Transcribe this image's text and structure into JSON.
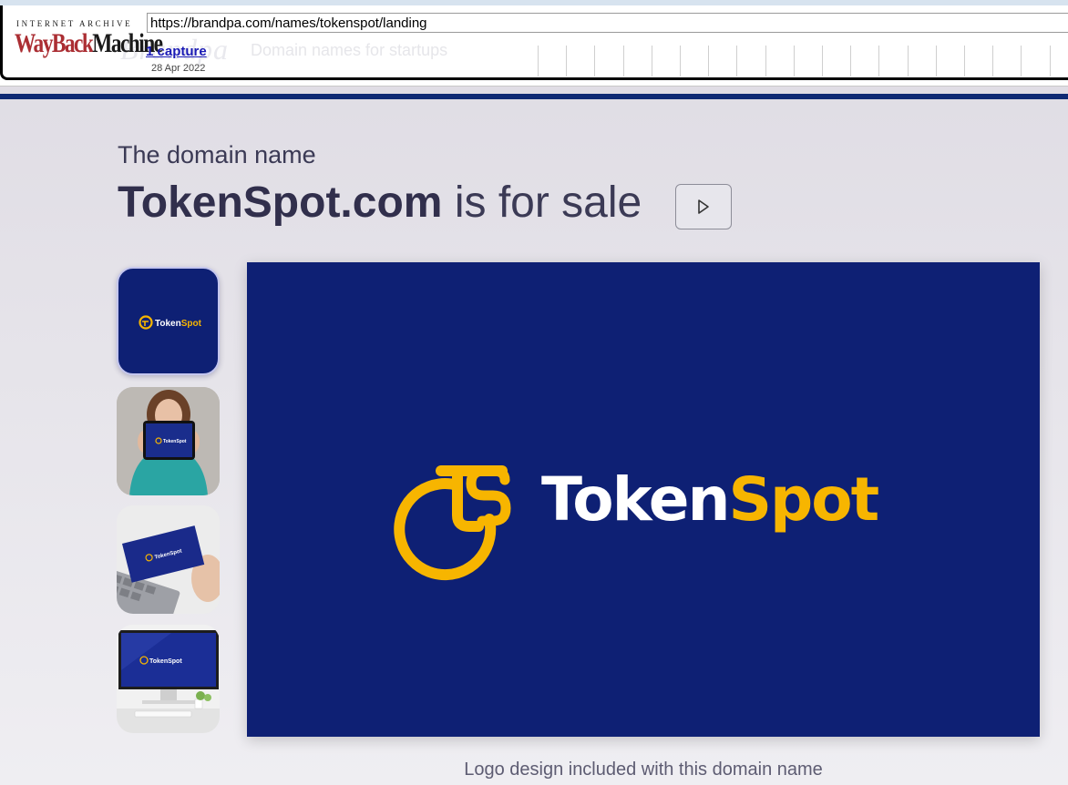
{
  "wayback": {
    "ia_label": "INTERNET ARCHIVE",
    "logo_wayback": "WayBack",
    "logo_machine": "Machine",
    "url": "https://brandpa.com/names/tokenspot/landing",
    "captures_label": "1 capture",
    "capture_date": "28 Apr 2022"
  },
  "site_header": {
    "brand": "Brandpa",
    "tagline": "Domain names for startups"
  },
  "hero": {
    "subtitle": "The domain name",
    "domain": "TokenSpot.com",
    "for_sale": "is for sale"
  },
  "gallery": {
    "thumbnails": [
      {
        "kind": "logo",
        "label": "TokenSpot"
      },
      {
        "kind": "tablet-mockup",
        "label": "TokenSpot"
      },
      {
        "kind": "business-card-mockup",
        "label": "TokenSpot"
      },
      {
        "kind": "monitor-mockup",
        "label": "TokenSpot"
      }
    ],
    "main_logo": {
      "part1": "Token",
      "part2": "Spot"
    }
  },
  "caption": "Logo design included with this domain name",
  "colors": {
    "brand_navy": "#0e2074",
    "logo_gold": "#f7b500",
    "heading_text": "#3b3a55",
    "nav_bar": "#0f2a74",
    "wayback_red": "#ab2e33"
  }
}
